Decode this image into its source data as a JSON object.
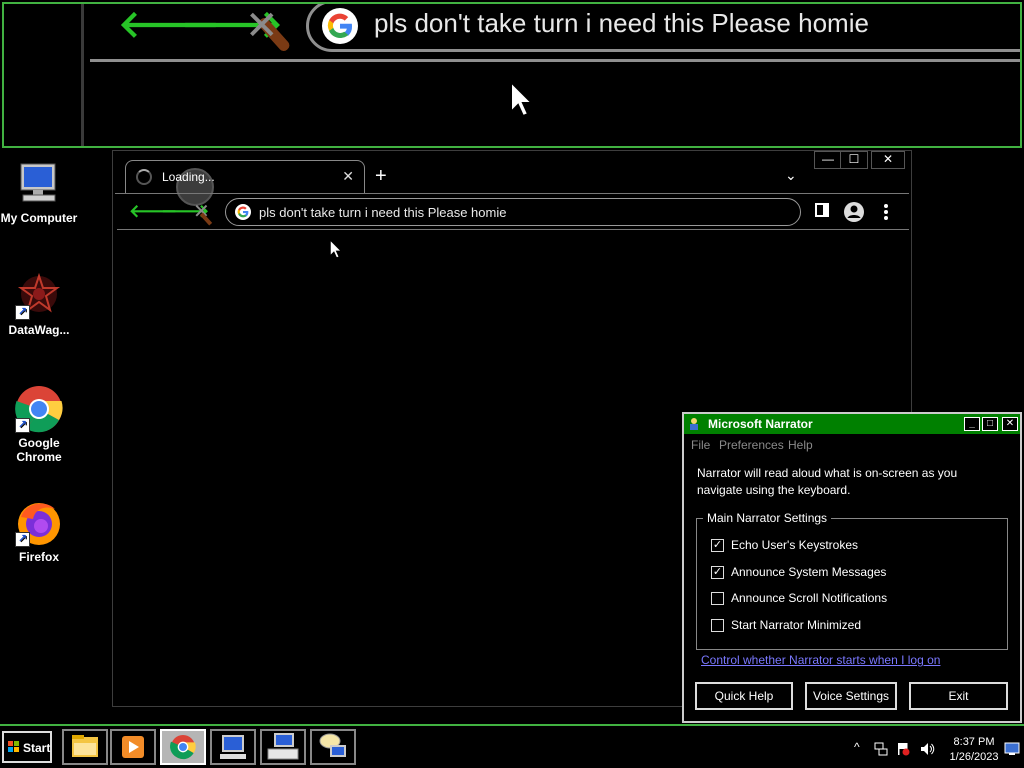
{
  "magnifier": {
    "url_text": "pls don't take turn i need this Please homie",
    "back_glyph": "🡐",
    "forward_glyph": "🡒",
    "stop_glyph": "✕"
  },
  "desktop_icons": [
    {
      "label": "My Computer",
      "icon": "computer-icon"
    },
    {
      "label": "DataWag...",
      "icon": "datawag-icon"
    },
    {
      "label": "Google Chrome",
      "icon": "chrome-icon"
    },
    {
      "label": "Firefox",
      "icon": "firefox-icon"
    }
  ],
  "chrome": {
    "minimize": "—",
    "maximize": "☐",
    "close": "✕",
    "tab_title": "Loading...",
    "tab_close": "✕",
    "new_tab": "+",
    "tab_menu": "⌄",
    "back_glyph": "🡐",
    "forward_glyph": "🡒",
    "stop_glyph": "✕",
    "omnibox_text": "pls don't take turn i need this Please homie"
  },
  "narrator": {
    "title": "Microsoft Narrator",
    "menu": [
      "File",
      "Preferences",
      "Help"
    ],
    "description": "Narrator will read aloud what is on-screen as you navigate using the keyboard.",
    "group_title": "Main Narrator Settings",
    "options": [
      {
        "label": "Echo User's Keystrokes",
        "checked": true
      },
      {
        "label": "Announce System Messages",
        "checked": true
      },
      {
        "label": "Announce Scroll Notifications",
        "checked": false
      },
      {
        "label": "Start Narrator Minimized",
        "checked": false
      }
    ],
    "link": "Control whether Narrator starts when I log on",
    "buttons": {
      "quick_help": "Quick Help",
      "voice_settings": "Voice Settings",
      "exit": "Exit"
    },
    "minimize": "_",
    "maximize": "□",
    "close": "✕"
  },
  "taskbar": {
    "start_label": "Start",
    "apps": [
      "file-explorer-icon",
      "media-player-icon",
      "chrome-icon",
      "computer-icon",
      "keyboard-icon",
      "narrator-icon"
    ],
    "active_app": "chrome-icon",
    "time": "8:37 PM",
    "date": "1/26/2023",
    "tray_chevron": "^"
  },
  "colors": {
    "accent_green": "#41b141",
    "nav_arrow_green": "#27c427",
    "narrator_title": "#008000",
    "link": "#7a78ff"
  }
}
